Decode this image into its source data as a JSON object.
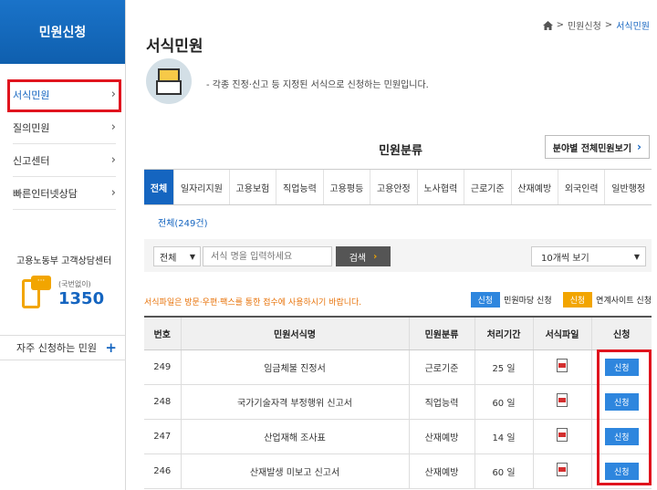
{
  "sidebar": {
    "title": "민원신청",
    "items": [
      {
        "label": "서식민원"
      },
      {
        "label": "질의민원"
      },
      {
        "label": "신고센터"
      },
      {
        "label": "빠른인터넷상담"
      }
    ],
    "consult_title": "고용노동부 고객상담센터",
    "consult_sub": "(국번없이)",
    "consult_number": "1350",
    "frequent": "자주 신청하는 민원",
    "frequent_icon": "+"
  },
  "breadcrumb": {
    "home_icon": "home-icon",
    "sep1": ">",
    "item1": "민원신청",
    "sep2": ">",
    "current": "서식민원"
  },
  "page_title": "서식민원",
  "intro_text": "- 각종 진정·신고 등 지정된 서식으로 신청하는 민원입니다.",
  "category": {
    "title": "민원분류",
    "view_all": "분야별 전체민원보기",
    "tabs": [
      "전체",
      "일자리지원",
      "고용보험",
      "직업능력",
      "고용평등",
      "고용안정",
      "노사협력",
      "근로기준",
      "산재예방",
      "외국인력",
      "일반행정"
    ]
  },
  "count_text": "전체(249건)",
  "search": {
    "scope": "전체",
    "placeholder": "서식 명을 입력하세요",
    "button": "검색",
    "page_size": "10개씩 보기"
  },
  "notice": "서식파일은 방문·우편·팩스를 통한 접수에 사용하시기 바랍니다.",
  "legend": {
    "blue_label": "신청",
    "blue_text": "민원마당 신청",
    "yellow_label": "신청",
    "yellow_text": "연계사이트 신청"
  },
  "table": {
    "headers": [
      "번호",
      "민원서식명",
      "민원분류",
      "처리기간",
      "서식파일",
      "신청"
    ],
    "rows": [
      {
        "no": "249",
        "name": "임금체불 진정서",
        "category": "근로기준",
        "period": "25 일",
        "apply": "신청"
      },
      {
        "no": "248",
        "name": "국가기술자격 부정행위 신고서",
        "category": "직업능력",
        "period": "60 일",
        "apply": "신청"
      },
      {
        "no": "247",
        "name": "산업재해 조사표",
        "category": "산재예방",
        "period": "14 일",
        "apply": "신청"
      },
      {
        "no": "246",
        "name": "산재발생 미보고 신고서",
        "category": "산재예방",
        "period": "60 일",
        "apply": "신청"
      }
    ]
  },
  "colors": {
    "primary": "#1565c0",
    "accent": "#f2a500",
    "highlight": "#e0141e"
  }
}
